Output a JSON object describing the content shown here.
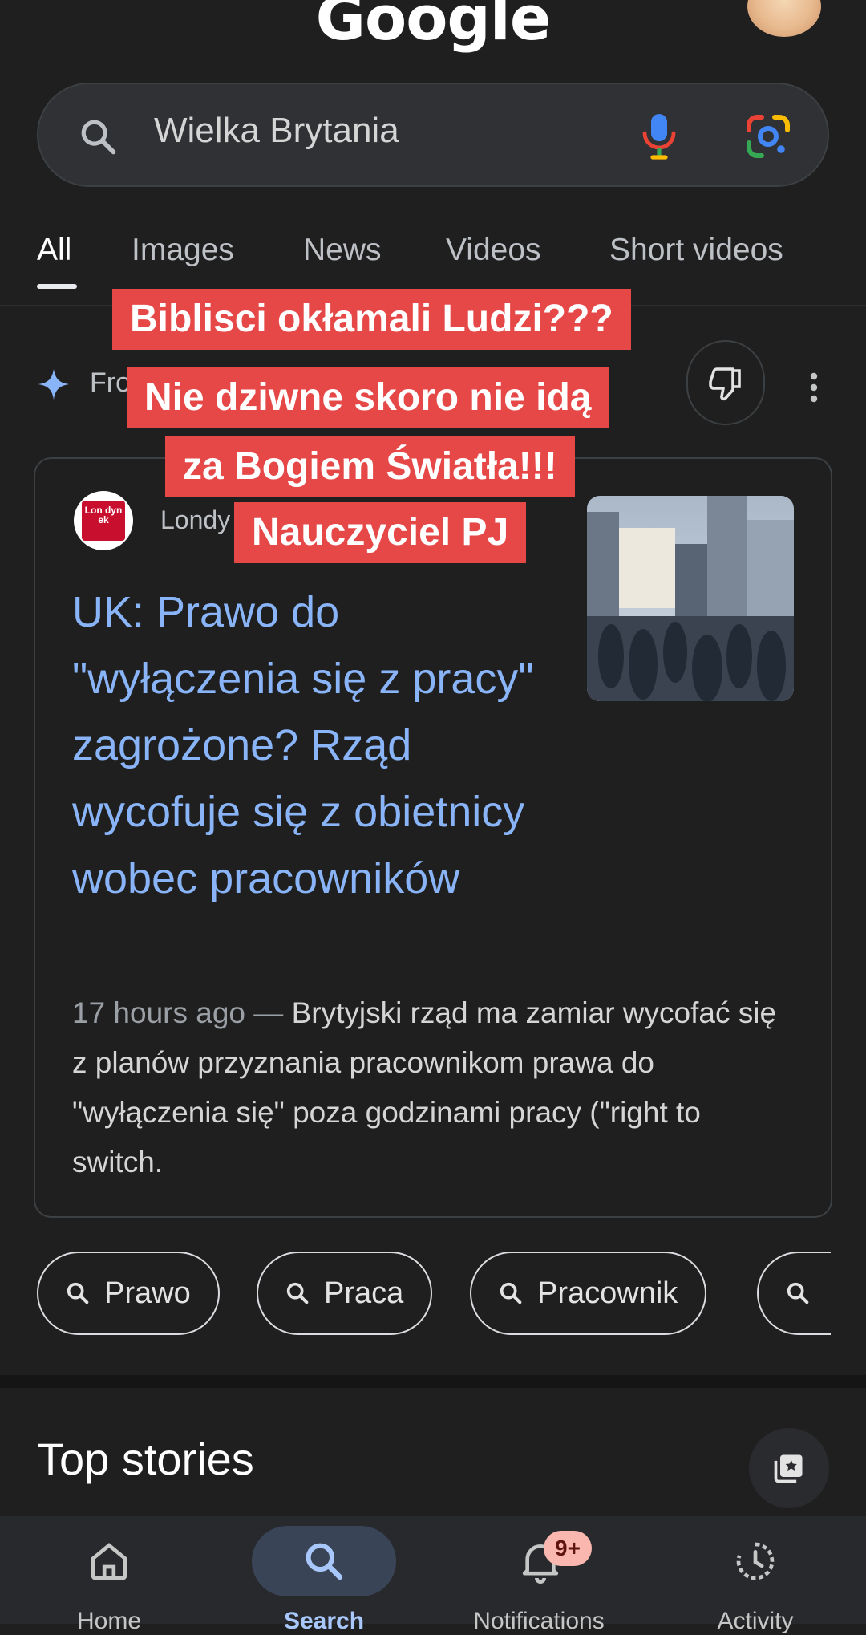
{
  "header": {
    "logo_text": "Google"
  },
  "search": {
    "query": "Wielka Brytania"
  },
  "tabs": [
    {
      "label": "All",
      "active": true
    },
    {
      "label": "Images"
    },
    {
      "label": "News"
    },
    {
      "label": "Videos"
    },
    {
      "label": "Short videos"
    }
  ],
  "ai_row": {
    "label_partial": "Fro"
  },
  "result": {
    "site_name": "Londy",
    "site_logo_text": "Lon dyn ek",
    "headline": "UK: Prawo do \"wyłączenia się z pracy\" zagrożone? Rząd wycofuje się z obietnicy wobec pracowników",
    "time": "17 hours ago",
    "separator": " — ",
    "snippet": "Brytyjski rząd ma zamiar wycofać się z planów przyznania pracownikom prawa do \"wyłączenia się\" poza godzinami pracy (\"right to switch."
  },
  "chips": [
    "Prawo",
    "Praca",
    "Pracownik"
  ],
  "top_stories": {
    "title": "Top stories"
  },
  "bottom_nav": {
    "items": [
      {
        "label": "Home"
      },
      {
        "label": "Search",
        "active": true
      },
      {
        "label": "Notifications",
        "badge": "9+"
      },
      {
        "label": "Activity"
      }
    ]
  },
  "overlay_caption": {
    "lines": [
      "Biblisci okłamali Ludzi???",
      "Nie dziwne skoro nie idą",
      "za Bogiem Światła!!!",
      "Nauczyciel PJ"
    ],
    "background": "#e64747"
  },
  "colors": {
    "background": "#1f1f1f",
    "link": "#8ab4f8",
    "active_nav": "#a8c7fa"
  }
}
